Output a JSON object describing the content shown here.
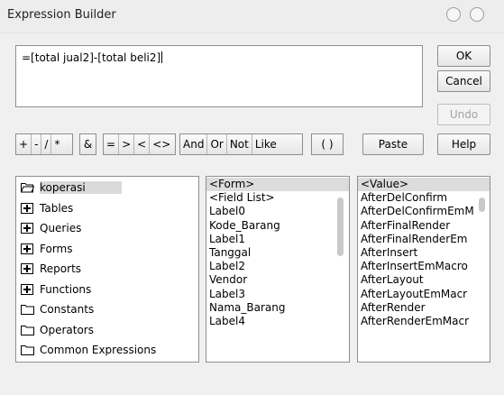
{
  "window": {
    "title": "Expression Builder"
  },
  "expression": {
    "text": "=[total jual2]-[total beli2]"
  },
  "buttons": {
    "ok": "OK",
    "cancel": "Cancel",
    "undo": "Undo",
    "paste": "Paste",
    "help": "Help"
  },
  "operators": {
    "arith": [
      "+",
      "-",
      "/",
      "*"
    ],
    "concat": "&",
    "compare": [
      "=",
      ">",
      "<",
      "<>"
    ],
    "logic": [
      "And",
      "Or",
      "Not",
      "Like"
    ],
    "paren": "( )"
  },
  "tree": {
    "items": [
      {
        "label": "koperasi",
        "icon": "folder-open-icon"
      },
      {
        "label": "Tables",
        "icon": "plus-box-icon"
      },
      {
        "label": "Queries",
        "icon": "plus-box-icon"
      },
      {
        "label": "Forms",
        "icon": "plus-box-icon"
      },
      {
        "label": "Reports",
        "icon": "plus-box-icon"
      },
      {
        "label": "Functions",
        "icon": "plus-box-icon"
      },
      {
        "label": "Constants",
        "icon": "folder-icon"
      },
      {
        "label": "Operators",
        "icon": "folder-icon"
      },
      {
        "label": "Common Expressions",
        "icon": "folder-icon"
      }
    ]
  },
  "middle_list": {
    "items": [
      "<Form>",
      "<Field List>",
      "Label0",
      "Kode_Barang",
      "Label1",
      "Tanggal",
      "Label2",
      "Vendor",
      "Label3",
      "Nama_Barang",
      "Label4"
    ]
  },
  "right_list": {
    "items": [
      "<Value>",
      "AfterDelConfirm",
      "AfterDelConfirmEmM",
      "AfterFinalRender",
      "AfterFinalRenderEm",
      "AfterInsert",
      "AfterInsertEmMacro",
      "AfterLayout",
      "AfterLayoutEmMacr",
      "AfterRender",
      "AfterRenderEmMacr"
    ]
  }
}
